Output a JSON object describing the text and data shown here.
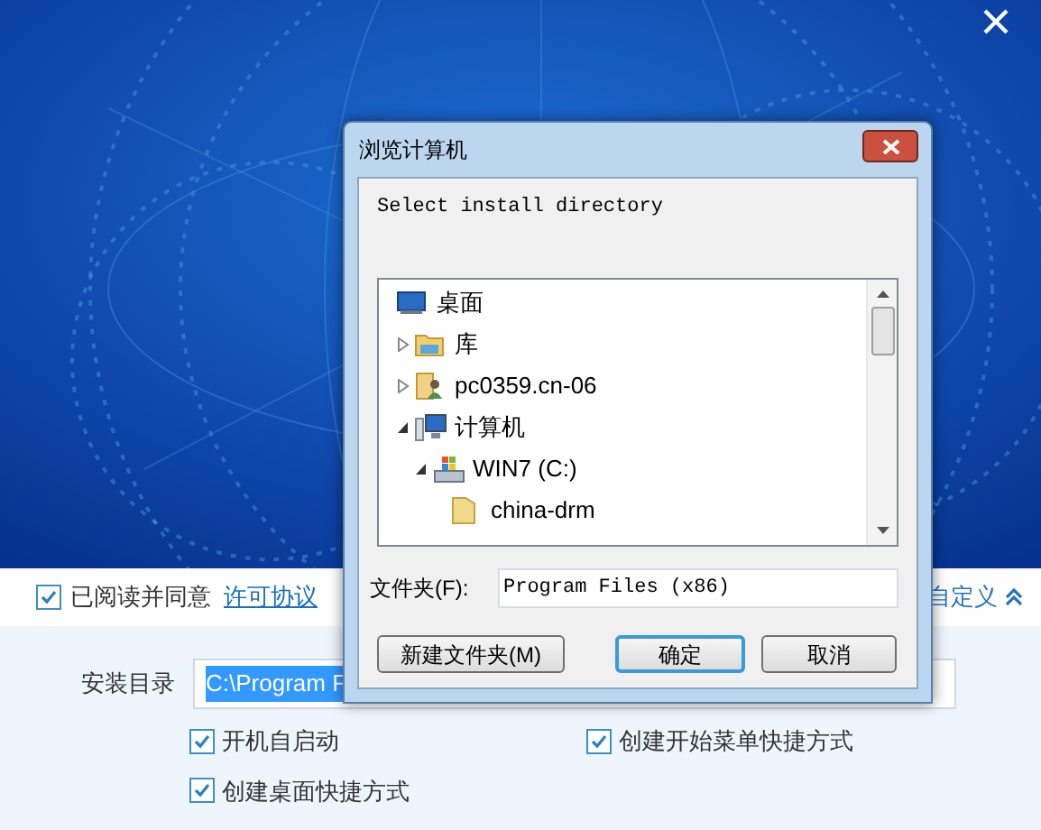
{
  "installer": {
    "agreement": {
      "checked": true,
      "text": "已阅读并同意",
      "link": "许可协议"
    },
    "customize": {
      "label": "自定义",
      "expanded": true
    },
    "install_dir": {
      "label": "安装目录",
      "value": "C:\\Program F",
      "text_selected": true
    },
    "options": [
      {
        "label": "开机自启动",
        "checked": true
      },
      {
        "label": "创建开始菜单快捷方式",
        "checked": true
      },
      {
        "label": "创建桌面快捷方式",
        "checked": true
      }
    ]
  },
  "dialog": {
    "title": "浏览计算机",
    "prompt": "Select install directory",
    "tree": [
      {
        "label": "桌面",
        "kind": "desktop",
        "children": [
          {
            "label": "库",
            "kind": "library",
            "expanded": false
          },
          {
            "label": "pc0359.cn-06",
            "kind": "user",
            "expanded": false
          },
          {
            "label": "计算机",
            "kind": "computer",
            "expanded": true,
            "children": [
              {
                "label": "WIN7 (C:)",
                "kind": "drive",
                "expanded": true,
                "children": [
                  {
                    "label": "china-drm",
                    "kind": "folder"
                  }
                ]
              }
            ]
          }
        ]
      }
    ],
    "folder": {
      "label": "文件夹(F):",
      "value": "Program Files (x86)"
    },
    "buttons": [
      {
        "label": "新建文件夹(M)",
        "default": false
      },
      {
        "label": "确定",
        "default": true
      },
      {
        "label": "取消",
        "default": false
      }
    ]
  }
}
